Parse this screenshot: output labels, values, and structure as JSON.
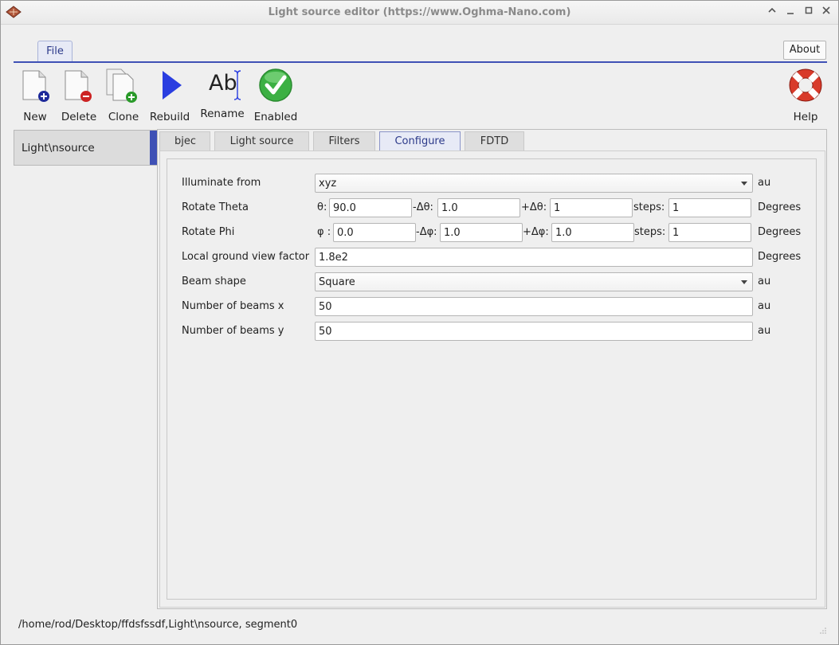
{
  "window": {
    "title": "Light source editor (https://www.Oghma-Nano.com)",
    "controls": [
      "^",
      "_",
      "□",
      "×"
    ]
  },
  "ribbon": {
    "file_tab": "File",
    "about_label": "About",
    "tools": [
      {
        "label": "New",
        "icon": "new-document-icon"
      },
      {
        "label": "Delete",
        "icon": "delete-document-icon"
      },
      {
        "label": "Clone",
        "icon": "clone-document-icon"
      },
      {
        "label": "Rebuild",
        "icon": "play-icon"
      },
      {
        "label": "Rename",
        "icon": "rename-text-icon",
        "glyph": "Ab"
      },
      {
        "label": "Enabled",
        "icon": "checkmark-icon"
      },
      {
        "label": "Help",
        "icon": "lifebuoy-icon"
      }
    ]
  },
  "sidebar": {
    "items": [
      {
        "label": "Light\\nsource"
      }
    ]
  },
  "tabs": [
    {
      "label": "bjec"
    },
    {
      "label": "Light source"
    },
    {
      "label": "Filters"
    },
    {
      "label": "Configure"
    },
    {
      "label": "FDTD"
    }
  ],
  "form": {
    "illuminate_from": {
      "label": "Illuminate from",
      "value": "xyz",
      "unit": "au"
    },
    "rotate_theta": {
      "label": "Rotate Theta",
      "prefix": "θ:",
      "value": "90.0",
      "minus_label": "-Δθ:",
      "minus_value": "1.0",
      "plus_label": "+Δθ:",
      "plus_value": "1",
      "steps_label": "steps:",
      "steps_value": "1",
      "unit": "Degrees"
    },
    "rotate_phi": {
      "label": "Rotate Phi",
      "prefix": "φ :",
      "value": "0.0",
      "minus_label": "-Δφ:",
      "minus_value": "1.0",
      "plus_label": "+Δφ:",
      "plus_value": "1.0",
      "steps_label": "steps:",
      "steps_value": "1",
      "unit": "Degrees"
    },
    "ground_view": {
      "label": "Local ground view factor",
      "value": "1.8e2",
      "unit": "Degrees"
    },
    "beam_shape": {
      "label": "Beam shape",
      "value": "Square",
      "unit": "au"
    },
    "beams_x": {
      "label": "Number of beams x",
      "value": "50",
      "unit": "au"
    },
    "beams_y": {
      "label": "Number of beams y",
      "value": "50",
      "unit": "au"
    }
  },
  "status": {
    "path": "/home/rod/Desktop/ffdsfssdf,Light\\nsource, segment0"
  },
  "colors": {
    "accent": "#3f51b5",
    "enabled_green": "#3cb043",
    "help_red": "#d83a2a",
    "play_blue": "#2a3ee0"
  }
}
